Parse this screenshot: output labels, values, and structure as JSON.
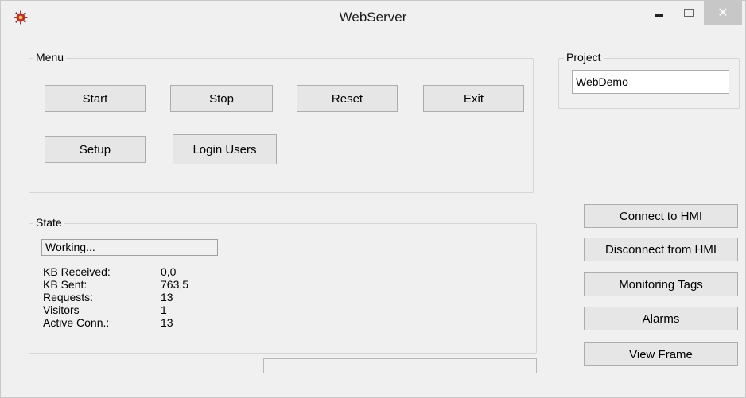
{
  "window": {
    "title": "WebServer",
    "icon": "gear-bug-icon",
    "controls": {
      "minimize": "minimize-icon",
      "maximize": "maximize-icon",
      "close": "close-icon",
      "close_glyph": "✕"
    }
  },
  "menu": {
    "label": "Menu",
    "start": "Start",
    "stop": "Stop",
    "reset": "Reset",
    "exit": "Exit",
    "setup": "Setup",
    "login_users": "Login Users"
  },
  "project": {
    "label": "Project",
    "value": "WebDemo"
  },
  "state": {
    "label": "State",
    "status": "Working...",
    "rows": [
      {
        "label": "KB Received:",
        "value": "0,0"
      },
      {
        "label": "KB Sent:",
        "value": "763,5"
      },
      {
        "label": "Requests:",
        "value": "13"
      },
      {
        "label": "Visitors",
        "value": "1"
      },
      {
        "label": "Active Conn.:",
        "value": "13"
      }
    ],
    "progress": 0
  },
  "hmi": {
    "connect": "Connect to HMI",
    "disconnect": "Disconnect from HMI",
    "monitoring": "Monitoring Tags",
    "alarms": "Alarms",
    "view_frame": "View Frame"
  },
  "colors": {
    "window_bg": "#f0f0f0",
    "button_bg": "#e6e6e6",
    "close_button_bg": "#c7c7c7"
  }
}
